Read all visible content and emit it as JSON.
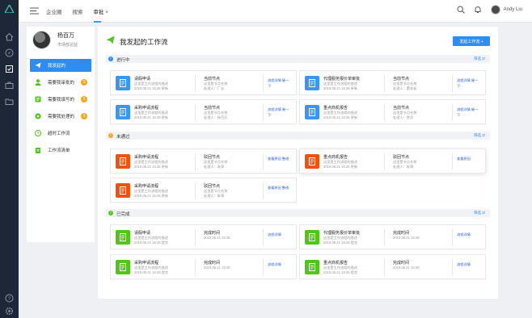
{
  "colors": {
    "accent": "#2e8df2",
    "rail": "#1e2738",
    "orange": "#f5a623",
    "red": "#f0520e",
    "green": "#52c41a",
    "blue": "#3a96f1"
  },
  "topbar": {
    "nav": [
      "企业圈",
      "搜索",
      "审批"
    ],
    "close_icon": "×",
    "user": "Andy Liu"
  },
  "profile": {
    "name": "杨百万",
    "role": "市场部总监"
  },
  "sidebar": {
    "items": [
      {
        "label": "我发起的",
        "icon": "paper-plane-icon",
        "active": true
      },
      {
        "label": "需要我审批的",
        "icon": "person-icon",
        "badge": "3"
      },
      {
        "label": "需要我填写的",
        "icon": "form-icon",
        "badge": "3"
      },
      {
        "label": "需要我处理的",
        "icon": "eye-icon",
        "badge": "3"
      },
      {
        "label": "超时工作流",
        "icon": "clock-icon"
      },
      {
        "label": "工作流清单",
        "icon": "clipboard-icon"
      }
    ]
  },
  "main": {
    "title": "我发起的工作流",
    "new_button": "发起工作流 +"
  },
  "sections": [
    {
      "title": "进行中",
      "dot": "!",
      "filter": "筛选 ⇄",
      "cards": [
        {
          "title": "请假申请",
          "sub1": "这里是工作流程的描述",
          "sub2": "2019.05.21  15:26  更新",
          "key": "当前节点",
          "val1": "这里是节点名称",
          "val2": "处理人：厂长",
          "link": "流程详情  催一下",
          "color": "blue"
        },
        {
          "title": "代理服务报价单审批",
          "sub1": "这里是工作流程的描述",
          "sub2": "2019.05.21  15:26  更新",
          "key": "当前节点",
          "val1": "这里是节点名称",
          "val2": "处理人：董老板",
          "link": "流程详情  催一下",
          "color": "blue"
        },
        {
          "title": "采购申请流程",
          "sub1": "这里是工作流程的描述",
          "sub2": "2019.05.21  15:26  更新",
          "key": "当前节点",
          "val1": "这里是节点名称",
          "val2": "处理人：杨百万",
          "link": "流程详情  催一下",
          "color": "blue"
        },
        {
          "title": "重点商机报告",
          "sub1": "这里是工作流程的描述",
          "sub2": "2019.05.21  15:26  更新",
          "key": "当前节点",
          "val1": "这里是节点名称",
          "val2": "处理人：贾总",
          "link": "流程详情  催一下",
          "color": "blue"
        }
      ]
    },
    {
      "title": "未通过",
      "dot": "!",
      "filter": "筛选 ⇄",
      "cards": [
        {
          "title": "采购申请流程",
          "sub1": "这里是工作流程的描述",
          "sub2": "2019.05.21  15:26  更新",
          "key": "驳回节点",
          "val1": "这里是节点名称",
          "val2": "处理人：耿哥",
          "link": "查看原因  整改",
          "color": "red"
        },
        {
          "title": "重点商机报告",
          "sub1": "这里是工作流程的描述",
          "sub2": "2019.05.21  15:26  更新",
          "key": "驳回节点",
          "val1": "这里是节点名称",
          "val2": "处理人：耿哥",
          "link": "查看原因",
          "color": "red"
        },
        {
          "title": "采购申请流程",
          "sub1": "这里是工作流程的描述",
          "sub2": "2019.05.21  15:26  更新",
          "key": "驳回节点",
          "val1": "这里是节点名称",
          "val2": "处理人：耿哥",
          "link": "查看原因  整改",
          "color": "red"
        }
      ]
    },
    {
      "title": "已完成",
      "dot": "✓",
      "filter": "筛选 ⇄",
      "cards": [
        {
          "title": "请假申请",
          "sub1": "这里是工作流程的描述",
          "sub2": "2019.05.21  15:26  提交",
          "key": "完成时间",
          "val1": "2019.05.21  15:26",
          "val2": "",
          "link": "流程详情",
          "color": "green"
        },
        {
          "title": "代理服务报价单审批",
          "sub1": "这里是工作流程的描述",
          "sub2": "2019.05.21  15:26  提交",
          "key": "完成时间",
          "val1": "2019.05.21  15:26",
          "val2": "",
          "link": "流程详情",
          "color": "green"
        },
        {
          "title": "采购申请流程",
          "sub1": "这里是工作流程的描述",
          "sub2": "2019.05.21  15:26  提交",
          "key": "完成时间",
          "val1": "2019.05.21  15:26",
          "val2": "",
          "link": "流程详情",
          "color": "green"
        },
        {
          "title": "重点商机报告",
          "sub1": "这里是工作流程的描述",
          "sub2": "2019.05.21  15:26  提交",
          "key": "完成时间",
          "val1": "2019.05.21  15:26",
          "val2": "",
          "link": "流程详情",
          "color": "green"
        }
      ]
    }
  ]
}
